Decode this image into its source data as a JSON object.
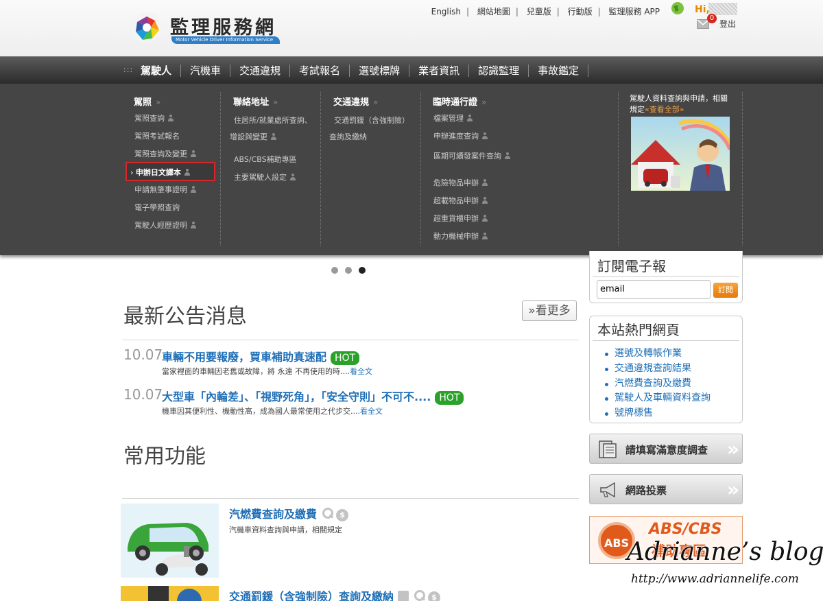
{
  "header": {
    "logo_title": "監理服務網",
    "logo_subtitle": "Motor Vehicle Driver Information Service",
    "top_links": [
      "English",
      "網站地圖",
      "兒童版",
      "行動版",
      "監理服務 APP"
    ],
    "greeting": "Hi,",
    "mail_count": "0",
    "logout_label": "登出"
  },
  "nav": {
    "dots": ":::",
    "items": [
      "駕駛人",
      "汽機車",
      "交通違規",
      "考試報名",
      "選號標牌",
      "業者資訊",
      "認識監理",
      "事故鑑定"
    ]
  },
  "megamenu": {
    "col1": {
      "title": "駕照",
      "items": [
        "駕照查詢",
        "駕照考試報名",
        "駕照查詢及變更",
        "申辦日文譯本",
        "申請無肇事證明",
        "電子學照查詢",
        "駕駛人經歷證明"
      ]
    },
    "col2": {
      "title": "聯絡地址",
      "items": [
        "住居所/就業處所查詢、增設與變更",
        "ABS/CBS補助專區",
        "主要駕駛人設定"
      ]
    },
    "col3": {
      "title": "交通違規",
      "items": [
        "交通罰鍰（含強制險）查詢及繳納"
      ]
    },
    "col4": {
      "title": "臨時通行證",
      "items": [
        "檔案管理",
        "申辦進度查詢",
        "區期可續發案件查詢",
        "危險物品申辦",
        "超載物品申辦",
        "超重貨櫃申辦",
        "動力機械申辦"
      ]
    },
    "promo": {
      "text": "駕駛人資料查詢與申請，相關規定",
      "link": "«查看全部»"
    },
    "arrow": "›",
    "raquo": "»"
  },
  "news": {
    "title": "最新公告消息",
    "more_label": "»看更多",
    "items": [
      {
        "date": "10.07",
        "title": "車輛不用要報廢，買車補助真速配",
        "badge": "HOT",
        "summary": "當家裡面的車輛因老舊或故障，將 永遠 不再使用的時....",
        "read": "看全文"
      },
      {
        "date": "10.07",
        "title": "大型車「內輪差」、「視野死角」，「安全守則」不可不....",
        "badge": "HOT",
        "summary": "機車因其便利性、機動性高，成為國人最常使用之代步交....",
        "read": "看全文"
      }
    ]
  },
  "functions": {
    "title": "常用功能",
    "items": [
      {
        "title": "汽燃費查詢及繳費",
        "desc": "汽機車資料查詢與申請，相關規定"
      },
      {
        "title": "交通罰鍰（含強制險）查詢及繳納",
        "desc": ""
      }
    ],
    "dollar_glyph": "$"
  },
  "sidebar": {
    "subscribe": {
      "title": "訂閱電子報",
      "input_value": "email",
      "button_label": "訂閱"
    },
    "hot_pages": {
      "title": "本站熱門網頁",
      "items": [
        "選號及轉帳作業",
        "交通違規查詢結果",
        "汽燃費查詢及繳費",
        "駕駛人及車輛資料查詢",
        "號牌標售"
      ]
    },
    "survey_label": "請填寫滿意度調查",
    "vote_label": "網路投票",
    "chevrons": "»",
    "abs_banner": {
      "circle": "ABS",
      "line1": "ABS/CBS",
      "line2": "補助專區"
    }
  },
  "watermark": {
    "line1": "Adrianne’s blog",
    "line2": "http://www.adriannelife.com"
  }
}
